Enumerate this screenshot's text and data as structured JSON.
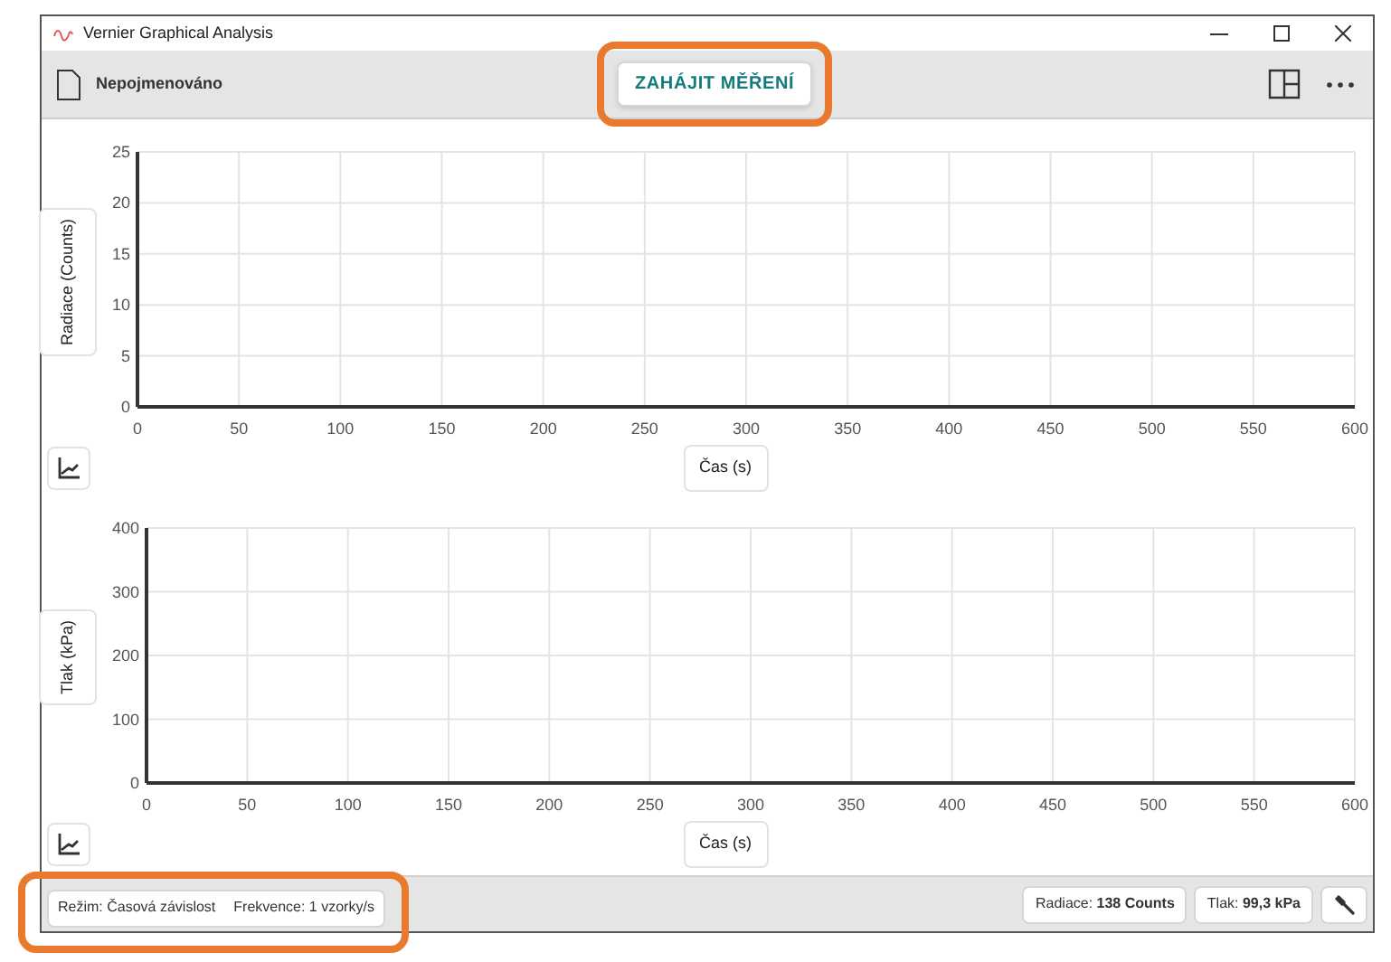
{
  "window": {
    "title": "Vernier Graphical Analysis"
  },
  "toolbar": {
    "document_name": "Nepojmenováno",
    "start_button": {
      "label": "ZAHÁJIT MĚŘENÍ",
      "highlighted": true
    }
  },
  "charts": [
    {
      "chart_data": {
        "type": "line",
        "xlabel": "Čas (s)",
        "ylabel": "Radiace (Counts)",
        "grid": true,
        "xlim": [
          0,
          600
        ],
        "ylim": [
          0,
          25
        ],
        "xticks": [
          0,
          50,
          100,
          150,
          200,
          250,
          300,
          350,
          400,
          450,
          500,
          550,
          600
        ],
        "yticks": [
          0,
          5,
          10,
          15,
          20,
          25
        ]
      }
    },
    {
      "chart_data": {
        "type": "line",
        "xlabel": "Čas (s)",
        "ylabel": "Tlak (kPa)",
        "grid": true,
        "xlim": [
          0,
          600
        ],
        "ylim": [
          0,
          400
        ],
        "xticks": [
          0,
          50,
          100,
          150,
          200,
          250,
          300,
          350,
          400,
          450,
          500,
          550,
          600
        ],
        "yticks": [
          0,
          100,
          200,
          300,
          400
        ]
      }
    }
  ],
  "status_bar": {
    "mode": "Režim: Časová závislost",
    "rate": "Frekvence: 1 vzorky/s",
    "highlighted": true,
    "readings": [
      "Radiace: **138 Counts**",
      "Tlak: **99,3 kPa**"
    ]
  }
}
